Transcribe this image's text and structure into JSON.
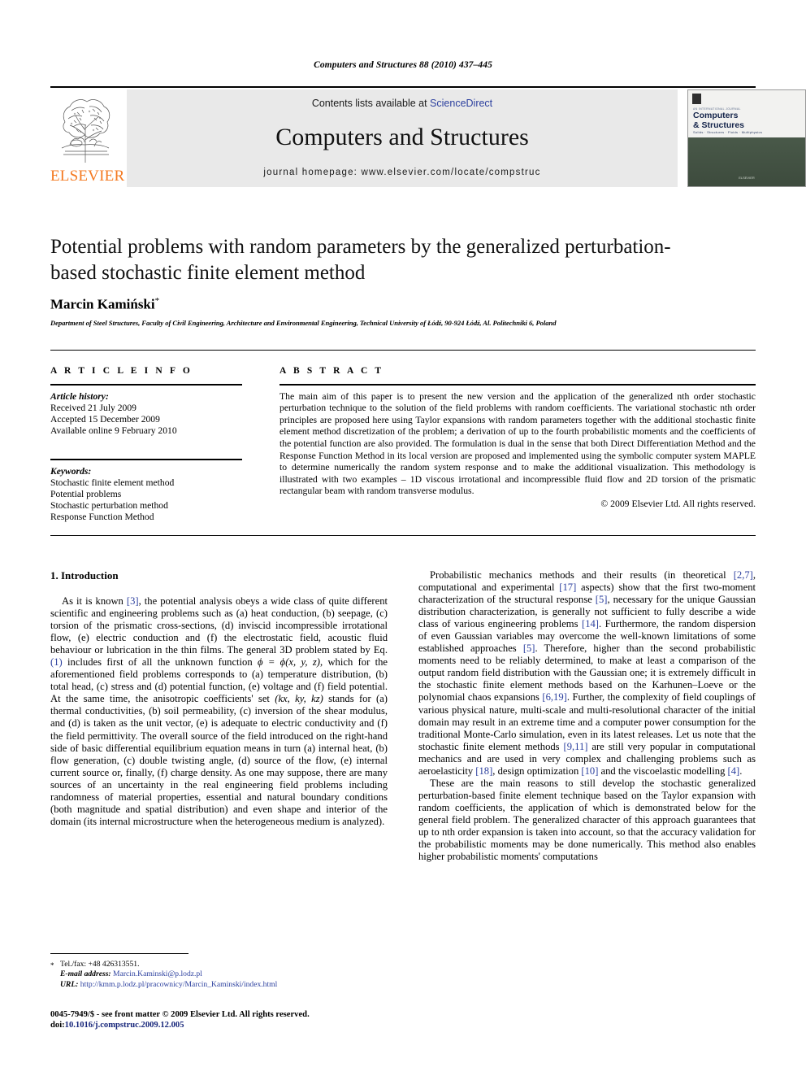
{
  "running_head": "Computers and Structures 88 (2010) 437–445",
  "masthead": {
    "contents_prefix": "Contents lists available at ",
    "sciencedirect": "ScienceDirect",
    "journal_title": "Computers and Structures",
    "homepage": "journal homepage: www.elsevier.com/locate/compstruc",
    "publisher_wordmark": "ELSEVIER",
    "publisher_color": "#f47920",
    "link_color": "#2b3f9e",
    "cover": {
      "issn_micro": "AN INTERNATIONAL JOURNAL",
      "name_line1": "Computers",
      "name_line2": "& Structures",
      "subtitle": "Solids · Structures · Fluids · Multiphysics",
      "footer": "ELSEVIER"
    }
  },
  "article": {
    "title": "Potential problems with random parameters by the generalized perturbation-based stochastic finite element method",
    "author": "Marcin Kamiński",
    "author_marker": "*",
    "affiliation": "Department of Steel Structures, Faculty of Civil Engineering, Architecture and Environmental Engineering, Technical University of Łódź, 90-924 Łódź, Al. Politechniki 6, Poland"
  },
  "article_info": {
    "section_label": "A R T I C L E   I N F O",
    "history_head": "Article history:",
    "history": [
      "Received 21 July 2009",
      "Accepted 15 December 2009",
      "Available online 9 February 2010"
    ],
    "keywords_head": "Keywords:",
    "keywords": [
      "Stochastic finite element method",
      "Potential problems",
      "Stochastic perturbation method",
      "Response Function Method"
    ]
  },
  "abstract": {
    "section_label": "A B S T R A C T",
    "text": "The main aim of this paper is to present the new version and the application of the generalized nth order stochastic perturbation technique to the solution of the field problems with random coefficients. The variational stochastic nth order principles are proposed here using Taylor expansions with random parameters together with the additional stochastic finite element method discretization of the problem; a derivation of up to the fourth probabilistic moments and the coefficients of the potential function are also provided. The formulation is dual in the sense that both Direct Differentiation Method and the Response Function Method in its local version are proposed and implemented using the symbolic computer system MAPLE to determine numerically the random system response and to make the additional visualization. This methodology is illustrated with two examples – 1D viscous irrotational and incompressible fluid flow and 2D torsion of the prismatic rectangular beam with random transverse modulus.",
    "copyright": "© 2009 Elsevier Ltd. All rights reserved."
  },
  "body": {
    "section_heading": "1. Introduction",
    "left_paragraph_1_a": "As it is known ",
    "left_ref_3": "[3]",
    "left_paragraph_1_b": ", the potential analysis obeys a wide class of quite different scientific and engineering problems such as (a) heat conduction, (b) seepage, (c) torsion of the prismatic cross-sections, (d) inviscid incompressible irrotational flow, (e) electric conduction and (f) the electrostatic field, acoustic fluid behaviour or lubrication in the thin films. The general 3D problem stated by Eq. ",
    "left_ref_eq1": "(1)",
    "left_paragraph_1_c": " includes first of all the unknown function ",
    "left_math_phi": "ϕ = ϕ(x, y, z)",
    "left_paragraph_1_d": ", which for the aforementioned field problems corresponds to (a) temperature distribution, (b) total head, (c) stress and (d) potential function, (e) voltage and (f) field potential. At the same time, the anisotropic coefficients' set ",
    "left_math_k": "(kx, ky, kz)",
    "left_paragraph_1_e": " stands for (a) thermal conductivities, (b) soil permeability, (c) inversion of the shear modulus, and (d) is taken as the unit vector, (e) is adequate to electric conductivity and (f) the field permittivity. The overall source of the field introduced on the right-hand side of basic differential equilibrium equation means in turn (a) internal heat, (b) flow generation, (c) double twisting angle, (d) source of the flow, (e) internal current source or, finally, (f) charge density. As one may suppose, there are many sources of an uncertainty in the real engineering field problems including randomness of material properties, essential and natural boundary conditions (both magnitude and spatial distribution) and even shape and interior of the domain (its internal microstructure when the heterogeneous medium is analyzed).",
    "right_p1_a": "Probabilistic mechanics methods and their results (in theoretical ",
    "right_ref_27": "[2,7]",
    "right_p1_b": ", computational and experimental ",
    "right_ref_17": "[17]",
    "right_p1_c": " aspects) show that the first two-moment characterization of the structural response ",
    "right_ref_5a": "[5]",
    "right_p1_d": ", necessary for the unique Gaussian distribution characterization, is generally not sufficient to fully describe a wide class of various engineering problems ",
    "right_ref_14": "[14]",
    "right_p1_e": ". Furthermore, the random dispersion of even Gaussian variables may overcome the well-known limitations of some established approaches ",
    "right_ref_5b": "[5]",
    "right_p1_f": ". Therefore, higher than the second probabilistic moments need to be reliably determined, to make at least a comparison of the output random field distribution with the Gaussian one; it is extremely difficult in the stochastic finite element methods based on the Karhunen–Loeve or the polynomial chaos expansions ",
    "right_ref_619": "[6,19]",
    "right_p1_g": ". Further, the complexity of field couplings of various physical nature, multi-scale and multi-resolutional character of the initial domain may result in an extreme time and a computer power consumption for the traditional Monte-Carlo simulation, even in its latest releases. Let us note that the stochastic finite element methods ",
    "right_ref_911": "[9,11]",
    "right_p1_h": " are still very popular in computational mechanics and are used in very complex and challenging problems such as aeroelasticity ",
    "right_ref_18": "[18]",
    "right_p1_i": ", design optimization ",
    "right_ref_10": "[10]",
    "right_p1_j": " and the viscoelastic modelling ",
    "right_ref_4": "[4]",
    "right_p1_k": ".",
    "right_p2": "These are the main reasons to still develop the stochastic generalized perturbation-based finite element technique based on the Taylor expansion with random coefficients, the application of which is demonstrated below for the general field problem. The generalized character of this approach guarantees that up to nth order expansion is taken into account, so that the accuracy validation for the probabilistic moments may be done numerically. This method also enables higher probabilistic moments' computations"
  },
  "footnotes": {
    "marker": "*",
    "tel": "Tel./fax: +48 426313551.",
    "email_label": "E-mail address:",
    "email": "Marcin.Kaminski@p.lodz.pl",
    "url_label": "URL:",
    "url": "http://kmm.p.lodz.pl/pracownicy/Marcin_Kaminski/index.html",
    "issn_line": "0045-7949/$ - see front matter © 2009 Elsevier Ltd. All rights reserved.",
    "doi_label": "doi:",
    "doi": "10.1016/j.compstruc.2009.12.005"
  }
}
